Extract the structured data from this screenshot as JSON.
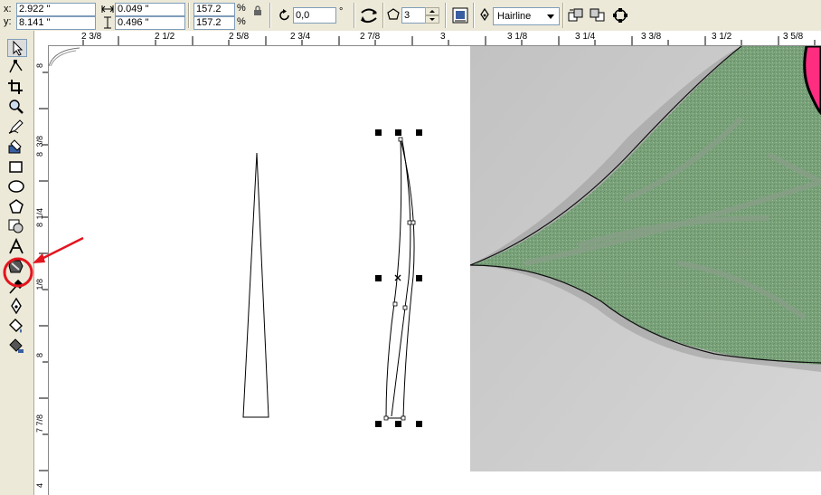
{
  "property_bar": {
    "x_label": "x:",
    "x_value": "2.922 \"",
    "y_label": "y:",
    "y_value": "8.141 \"",
    "width_value": "0.049 \"",
    "height_value": "0.496 \"",
    "scale_x": "157.2",
    "scale_y": "157.2",
    "percent_x": "%",
    "percent_y": "%",
    "rotation_value": "0,0",
    "degree_symbol": "°",
    "sides_value": "3",
    "outline_width": "Hairline"
  },
  "ruler_horizontal": [
    "2 3/8",
    "2 1/2",
    "2 5/8",
    "2 3/4",
    "2 7/8",
    "3",
    "3 1/8",
    "3 1/4",
    "3 3/8",
    "3 1/2",
    "3 5/8"
  ],
  "ruler_vertical": [
    "8",
    "3/8",
    "8",
    "1/4",
    "8",
    "1/8",
    "8",
    "7 7/8",
    "4"
  ],
  "toolbox": {
    "tools": [
      "pick-tool",
      "shape-tool",
      "crop-tool",
      "zoom-tool",
      "freehand-tool",
      "smart-fill-tool",
      "rectangle-tool",
      "ellipse-tool",
      "polygon-tool",
      "basic-shapes-tool",
      "text-tool",
      "interactive-fill-tool",
      "eyedropper-tool",
      "outline-tool",
      "fill-tool",
      "interactive-fill-2-tool"
    ],
    "highlighted_tool": "interactive-fill-tool"
  },
  "colors": {
    "chrome": "#ece9d8",
    "annotation": "#e4141e",
    "leaf_green": "#6f9a6f",
    "paper_gray": "#c9c9c9",
    "pink_accent": "#ff2d80"
  }
}
